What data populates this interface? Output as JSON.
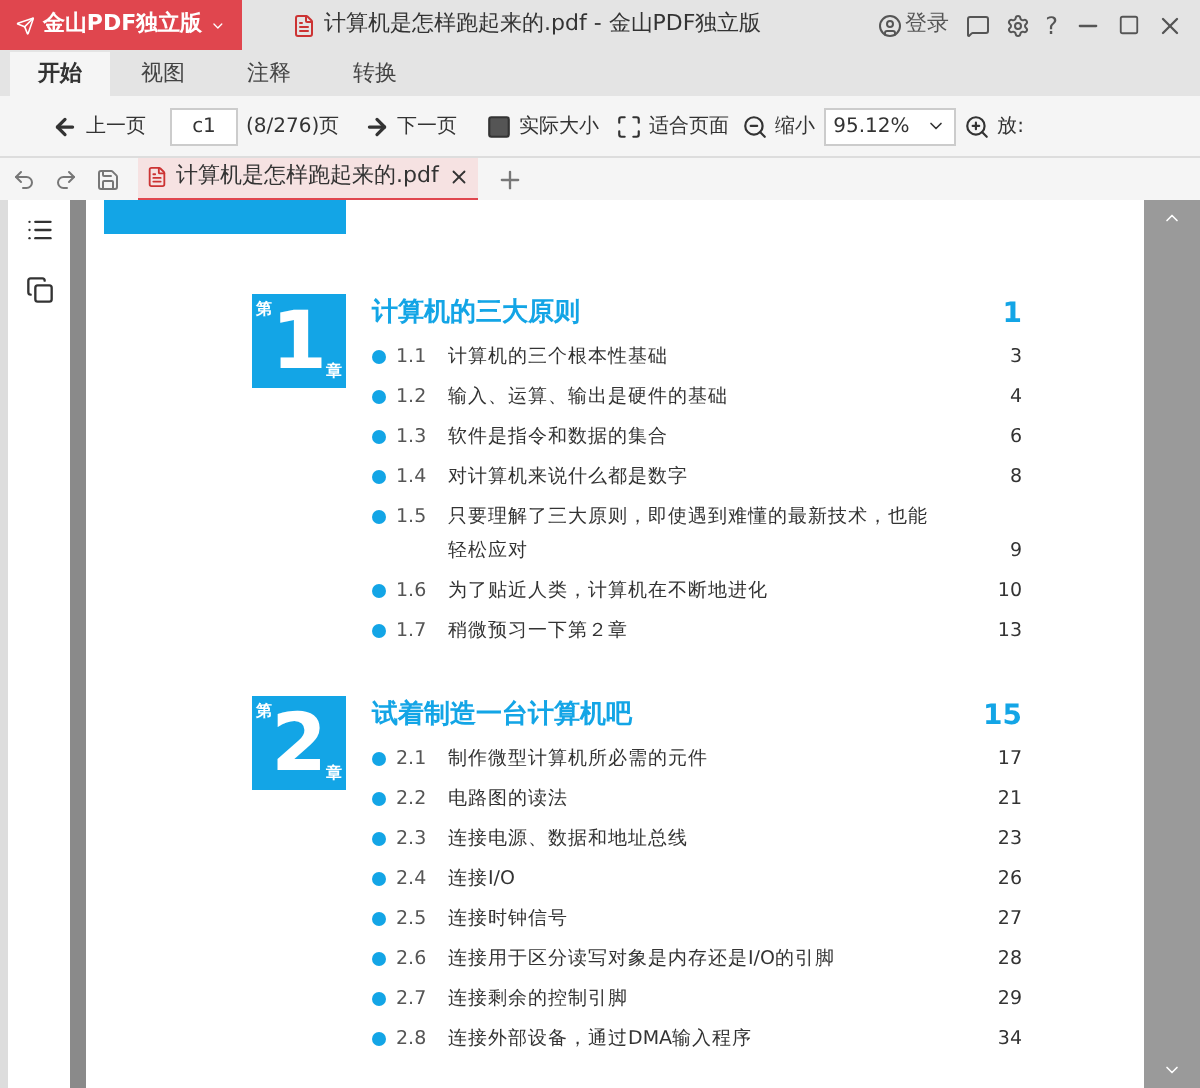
{
  "app": {
    "logo": "金山PDF独立版",
    "title": "计算机是怎样跑起来的.pdf - 金山PDF独立版",
    "login": "登录",
    "help": "?"
  },
  "ribbon_tabs": [
    {
      "label": "开始",
      "selected": true
    },
    {
      "label": "视图",
      "selected": false
    },
    {
      "label": "注释",
      "selected": false
    },
    {
      "label": "转换",
      "selected": false
    }
  ],
  "toolbar": {
    "prev": "上一页",
    "page_value": "c1",
    "page_count": "(8/276)页",
    "next": "下一页",
    "actual_size": "实际大小",
    "fit_page": "适合页面",
    "zoom_out": "缩小",
    "zoom_value": "95.12%",
    "zoom_in": "放:"
  },
  "doc_tabs": [
    {
      "label": "计算机是怎样跑起来的.pdf",
      "selected": true
    }
  ],
  "chapters": [
    {
      "prefix": "第",
      "number": "1",
      "suffix": "章",
      "title": "计算机的三大原则",
      "page": "1",
      "items": [
        {
          "num": "1.1",
          "lines": [
            "计算机的三个根本性基础"
          ],
          "page": "3"
        },
        {
          "num": "1.2",
          "lines": [
            "输入、运算、输出是硬件的基础"
          ],
          "page": "4"
        },
        {
          "num": "1.3",
          "lines": [
            "软件是指令和数据的集合"
          ],
          "page": "6"
        },
        {
          "num": "1.4",
          "lines": [
            "对计算机来说什么都是数字"
          ],
          "page": "8"
        },
        {
          "num": "1.5",
          "lines": [
            "只要理解了三大原则，即使遇到难懂的最新技术，也能",
            "轻松应对"
          ],
          "page": "9"
        },
        {
          "num": "1.6",
          "lines": [
            "为了贴近人类，计算机在不断地进化"
          ],
          "page": "10"
        },
        {
          "num": "1.7",
          "lines": [
            "稍微预习一下第２章"
          ],
          "page": "13"
        }
      ]
    },
    {
      "prefix": "第",
      "number": "2",
      "suffix": "章",
      "title": "试着制造一台计算机吧",
      "page": "15",
      "items": [
        {
          "num": "2.1",
          "lines": [
            "制作微型计算机所必需的元件"
          ],
          "page": "17"
        },
        {
          "num": "2.2",
          "lines": [
            "电路图的读法"
          ],
          "page": "21"
        },
        {
          "num": "2.3",
          "lines": [
            "连接电源、数据和地址总线"
          ],
          "page": "23"
        },
        {
          "num": "2.4",
          "lines": [
            "连接I/O"
          ],
          "page": "26"
        },
        {
          "num": "2.5",
          "lines": [
            "连接时钟信号"
          ],
          "page": "27"
        },
        {
          "num": "2.6",
          "lines": [
            "连接用于区分读写对象是内存还是I/O的引脚"
          ],
          "page": "28"
        },
        {
          "num": "2.7",
          "lines": [
            "连接剩余的控制引脚"
          ],
          "page": "29"
        },
        {
          "num": "2.8",
          "lines": [
            "连接外部设备，通过DMA输入程序"
          ],
          "page": "34"
        }
      ]
    }
  ]
}
